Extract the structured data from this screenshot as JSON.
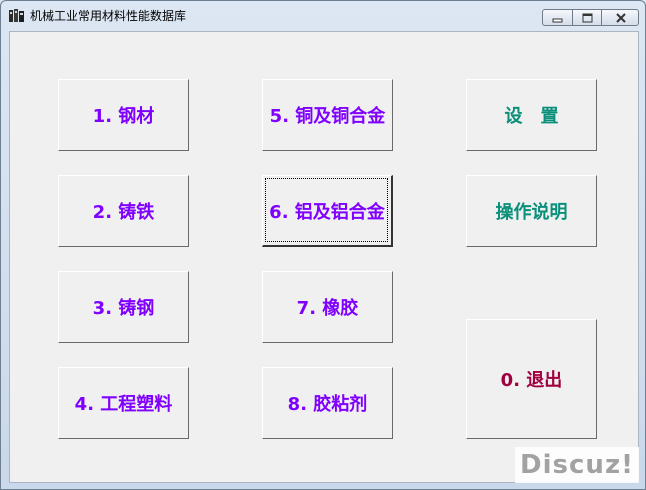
{
  "window": {
    "title": "机械工业常用材料性能数据库"
  },
  "colors": {
    "purple": "#8000ff",
    "teal": "#0a8f7a",
    "maroon": "#a00040"
  },
  "buttons": {
    "steel": "1. 钢材",
    "cast_iron": "2. 铸铁",
    "cast_steel": "3. 铸钢",
    "engineering_plastics": "4. 工程塑料",
    "copper_alloys": "5. 铜及铜合金",
    "aluminum_alloys": "6. 铝及铝合金",
    "rubber": "7. 橡胶",
    "adhesives": "8. 胶粘剂",
    "settings": "设　置",
    "instructions": "操作说明",
    "exit": "0. 退出"
  },
  "watermark": "Discuz!"
}
